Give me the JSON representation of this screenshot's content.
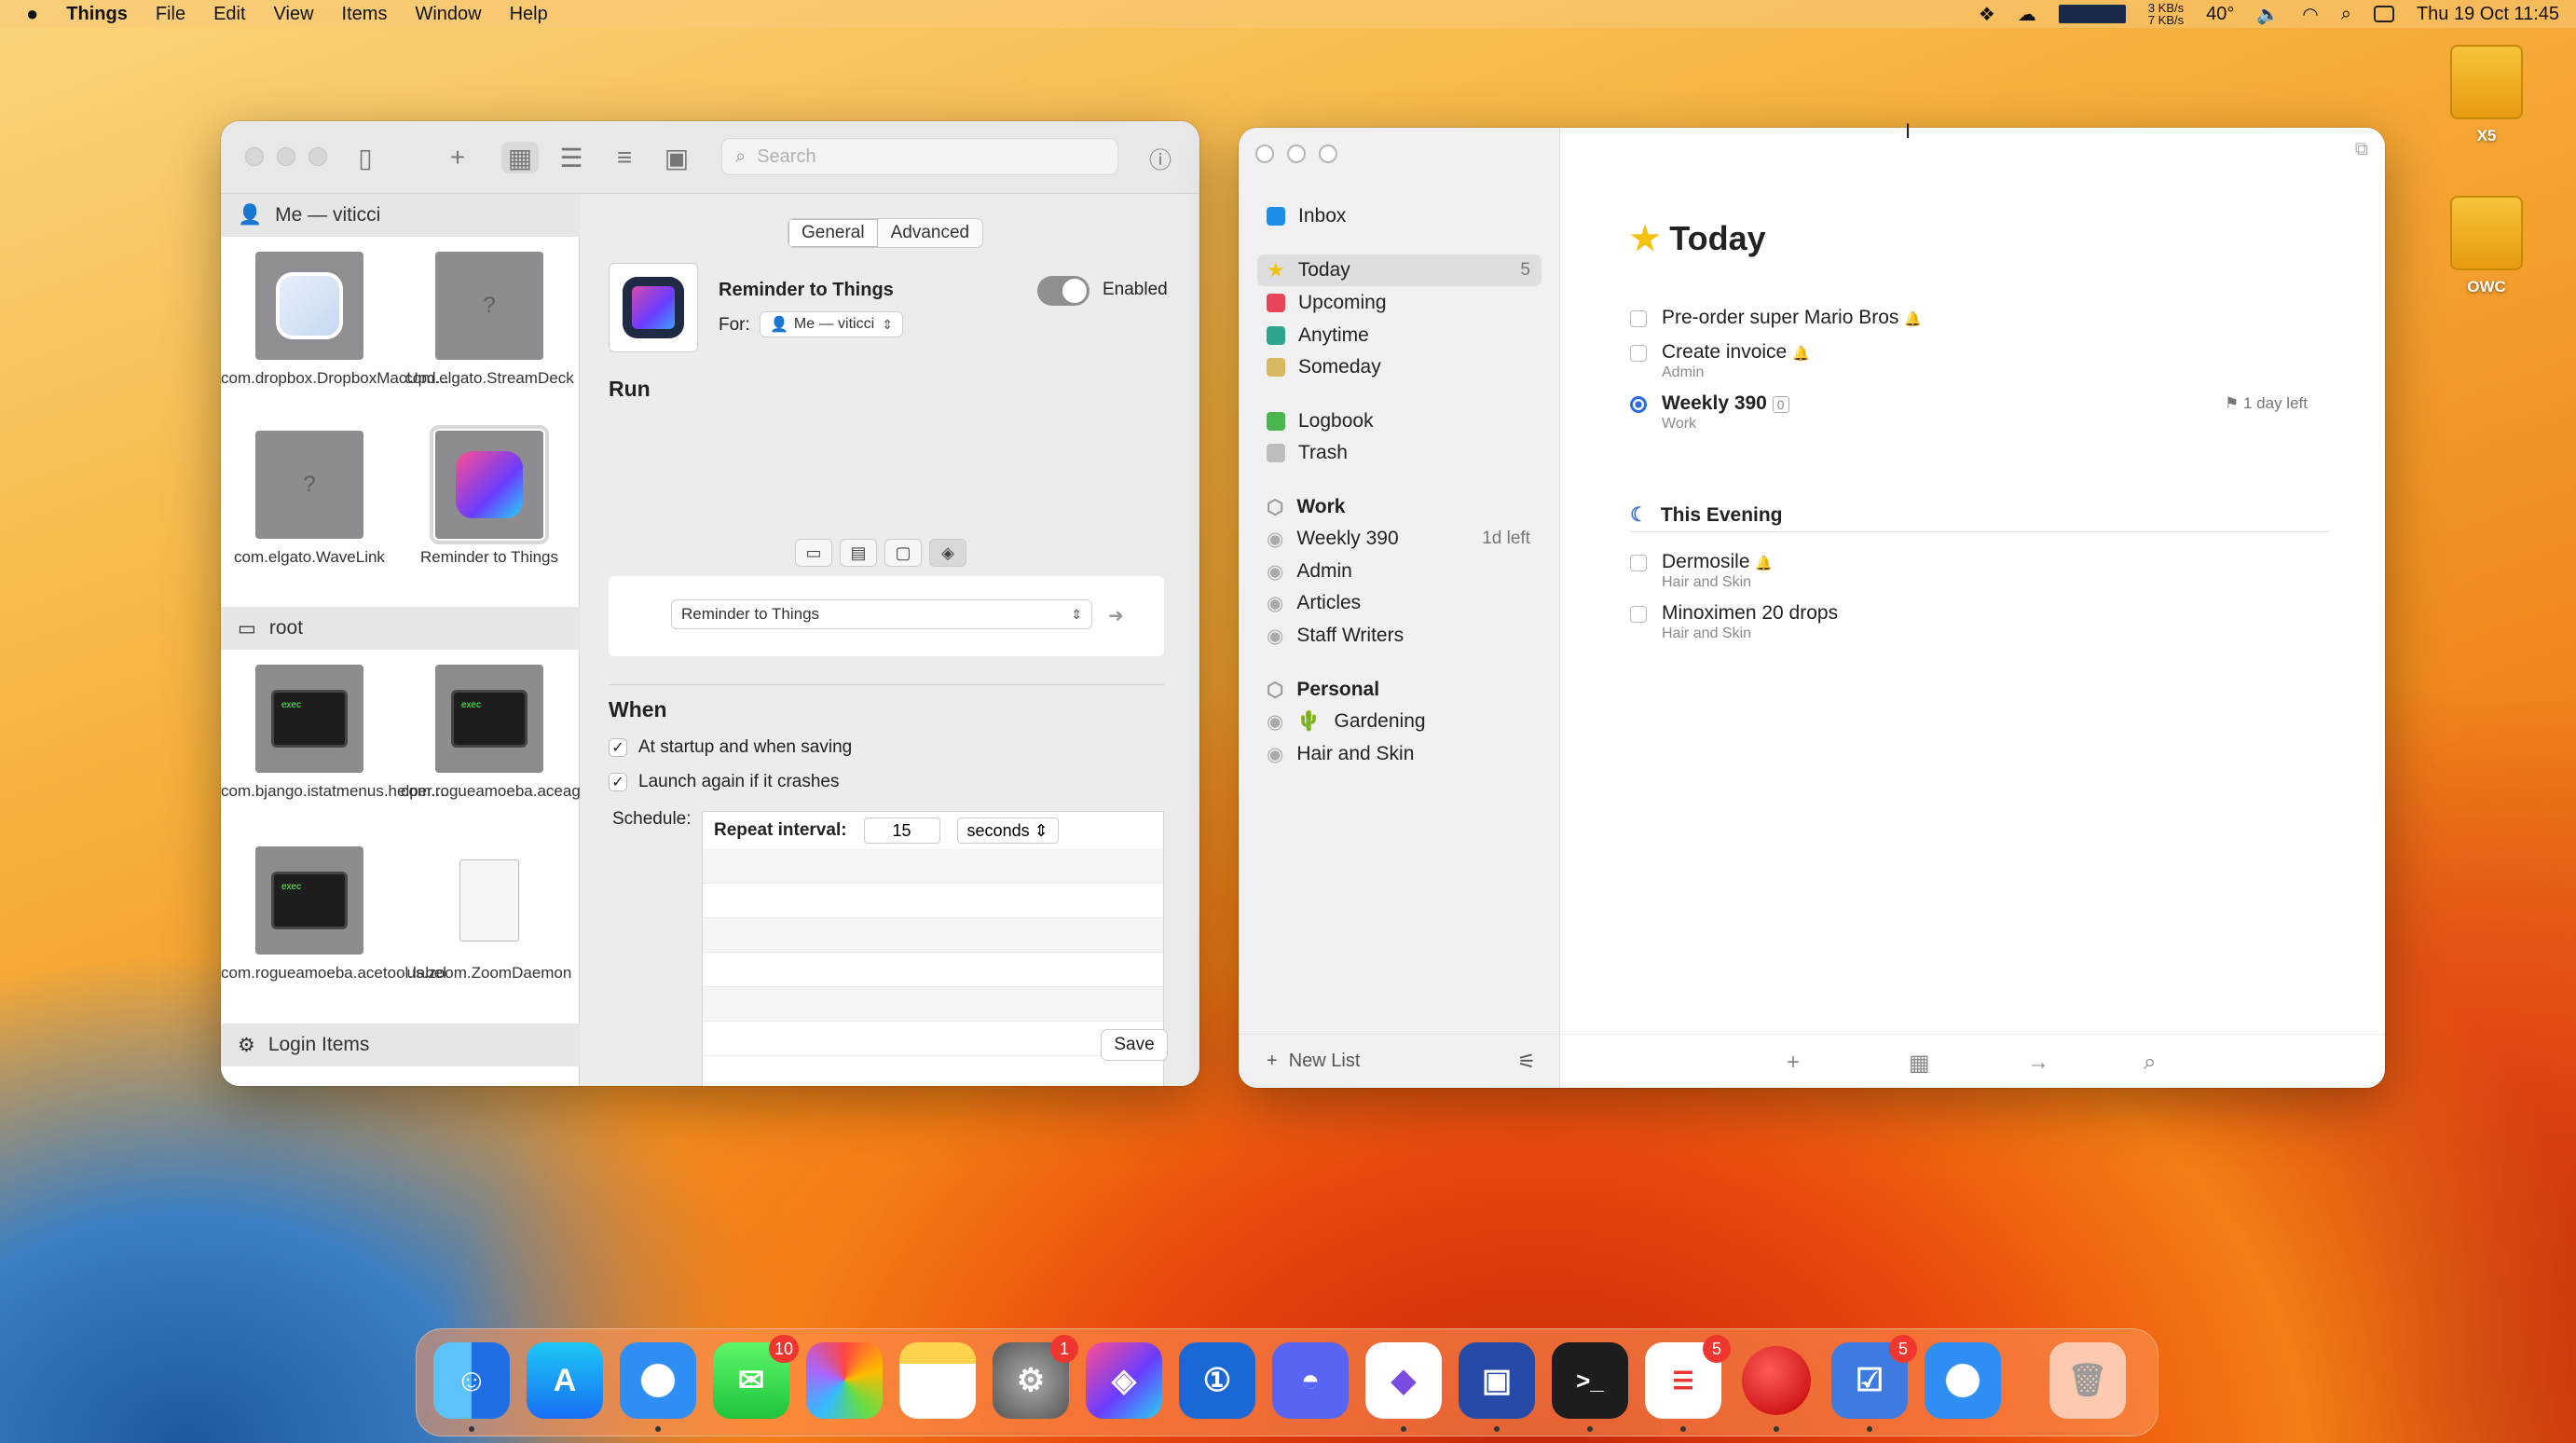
{
  "menubar": {
    "app": "Things",
    "items": [
      "File",
      "Edit",
      "View",
      "Items",
      "Window",
      "Help"
    ],
    "net_up": "3 KB/s",
    "net_down": "7 KB/s",
    "temp": "40°",
    "clock": "Thu 19 Oct  11:45"
  },
  "lingon": {
    "search_placeholder": "Search",
    "groups": [
      {
        "label": "Me — viticci"
      },
      {
        "label": "root"
      },
      {
        "label": "Login Items"
      }
    ],
    "items": [
      {
        "label": "com.dropbox.DropboxMacUpd..."
      },
      {
        "label": "com.elgato.StreamDeck"
      },
      {
        "label": "com.elgato.WaveLink"
      },
      {
        "label": "Reminder to Things"
      },
      {
        "label": "com.bjango.istatmenus.helper...."
      },
      {
        "label": "com.rogueamoeba.aceagent.la..."
      },
      {
        "label": "com.rogueamoeba.acetool.label"
      },
      {
        "label": "us.zoom.ZoomDaemon"
      }
    ],
    "tabs": {
      "general": "General",
      "advanced": "Advanced"
    },
    "job_name": "Reminder to Things",
    "enabled_label": "Enabled",
    "for_label": "For:",
    "for_value": "Me — viticci",
    "run_heading": "Run",
    "run_value": "Reminder to Things",
    "when_heading": "When",
    "check1": "At startup and when saving",
    "check2": "Launch again if it crashes",
    "schedule_label": "Schedule:",
    "repeat_label": "Repeat interval:",
    "repeat_value": "15",
    "repeat_unit": "seconds",
    "help": "?",
    "save": "Save"
  },
  "things": {
    "nav": {
      "inbox": "Inbox",
      "today": "Today",
      "today_count": "5",
      "upcoming": "Upcoming",
      "anytime": "Anytime",
      "someday": "Someday",
      "logbook": "Logbook",
      "trash": "Trash"
    },
    "areas": [
      {
        "name": "Work",
        "projects": [
          {
            "name": "Weekly 390",
            "meta": "1d left"
          },
          {
            "name": "Admin"
          },
          {
            "name": "Articles"
          },
          {
            "name": "Staff Writers"
          }
        ]
      },
      {
        "name": "Personal",
        "projects": [
          {
            "name": "Gardening",
            "emoji": "🌵"
          },
          {
            "name": "Hair and Skin"
          }
        ]
      }
    ],
    "new_list": "New List",
    "title": "Today",
    "tasks": [
      {
        "title": "Pre-order super Mario Bros",
        "sub": ""
      },
      {
        "title": "Create invoice",
        "sub": "Admin"
      },
      {
        "title": "Weekly 390",
        "sub": "Work",
        "badge": "0",
        "deadline": "1 day left"
      }
    ],
    "evening_title": "This Evening",
    "evening_tasks": [
      {
        "title": "Dermosile",
        "sub": "Hair and Skin"
      },
      {
        "title": "Minoximen 20 drops",
        "sub": "Hair and Skin"
      }
    ]
  },
  "desktop": {
    "drives": [
      {
        "label": "X5"
      },
      {
        "label": "OWC"
      }
    ]
  },
  "dock": {
    "badges": {
      "messages": "10",
      "settings": "1",
      "reminders": "5",
      "omnifocus": "5"
    }
  }
}
